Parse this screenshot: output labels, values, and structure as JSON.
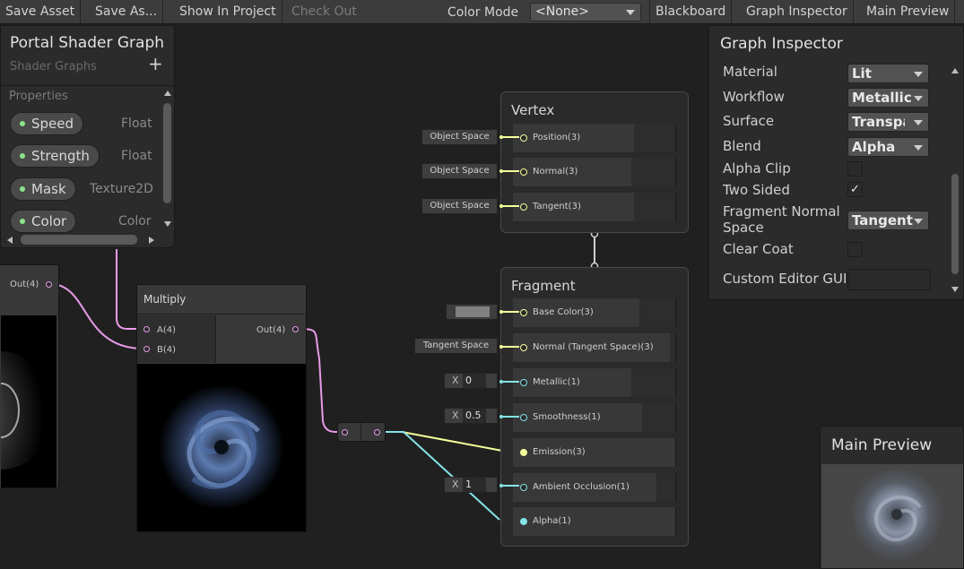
{
  "toolbar": {
    "save_asset": "Save Asset",
    "save_as": "Save As...",
    "show_in_project": "Show In Project",
    "check_out": "Check Out",
    "color_mode_label": "Color Mode",
    "color_mode_value": "<None>",
    "blackboard": "Blackboard",
    "graph_inspector": "Graph Inspector",
    "main_preview": "Main Preview"
  },
  "blackboard": {
    "title": "Portal Shader Graph",
    "subtitle": "Shader Graphs",
    "add": "+",
    "section": "Properties",
    "properties": [
      {
        "name": "Speed",
        "type": "Float"
      },
      {
        "name": "Strength",
        "type": "Float"
      },
      {
        "name": "Mask",
        "type": "Texture2D"
      },
      {
        "name": "Color",
        "type": "Color"
      }
    ]
  },
  "left_node": {
    "out_label": "Out(4)"
  },
  "multiply_node": {
    "title": "Multiply",
    "inputs": [
      "A(4)",
      "B(4)"
    ],
    "output": "Out(4)"
  },
  "vertex_stack": {
    "title": "Vertex",
    "blocks": [
      {
        "label": "Position(3)",
        "input": "Object Space"
      },
      {
        "label": "Normal(3)",
        "input": "Object Space"
      },
      {
        "label": "Tangent(3)",
        "input": "Object Space"
      }
    ]
  },
  "fragment_stack": {
    "title": "Fragment",
    "blocks": [
      {
        "label": "Base Color(3)",
        "input_type": "color",
        "input": ""
      },
      {
        "label": "Normal (Tangent Space)(3)",
        "input_type": "text",
        "input": "Tangent Space"
      },
      {
        "label": "Metallic(1)",
        "input_type": "x",
        "x": "X",
        "input": "0"
      },
      {
        "label": "Smoothness(1)",
        "input_type": "x",
        "x": "X",
        "input": "0.5"
      },
      {
        "label": "Emission(3)",
        "input_type": "none",
        "input": ""
      },
      {
        "label": "Ambient Occlusion(1)",
        "input_type": "x",
        "x": "X",
        "input": "1"
      },
      {
        "label": "Alpha(1)",
        "input_type": "none",
        "input": ""
      }
    ]
  },
  "inspector": {
    "title": "Graph Inspector",
    "rows": [
      {
        "label": "Material",
        "kind": "dropdown",
        "value": "Lit"
      },
      {
        "label": "Workflow",
        "kind": "dropdown",
        "value": "Metallic"
      },
      {
        "label": "Surface",
        "kind": "dropdown",
        "value": "Transparent"
      },
      {
        "label": "Blend",
        "kind": "dropdown",
        "value": "Alpha"
      },
      {
        "label": "Alpha Clip",
        "kind": "checkbox",
        "checked": false
      },
      {
        "label": "Two Sided",
        "kind": "checkbox",
        "checked": true
      },
      {
        "label": "Fragment Normal Space",
        "kind": "dropdown",
        "value": "Tangent"
      },
      {
        "label": "Clear Coat",
        "kind": "checkbox",
        "checked": false
      },
      {
        "label": "Custom Editor GUI",
        "kind": "text",
        "value": ""
      }
    ],
    "check_glyph": "✓"
  },
  "main_preview": {
    "title": "Main Preview"
  },
  "colors": {
    "vector4_wire": "#e79be7",
    "vector3_wire": "#f6ff9a",
    "vector1_wire": "#84e4e7",
    "property_dot": "#8be28b"
  }
}
